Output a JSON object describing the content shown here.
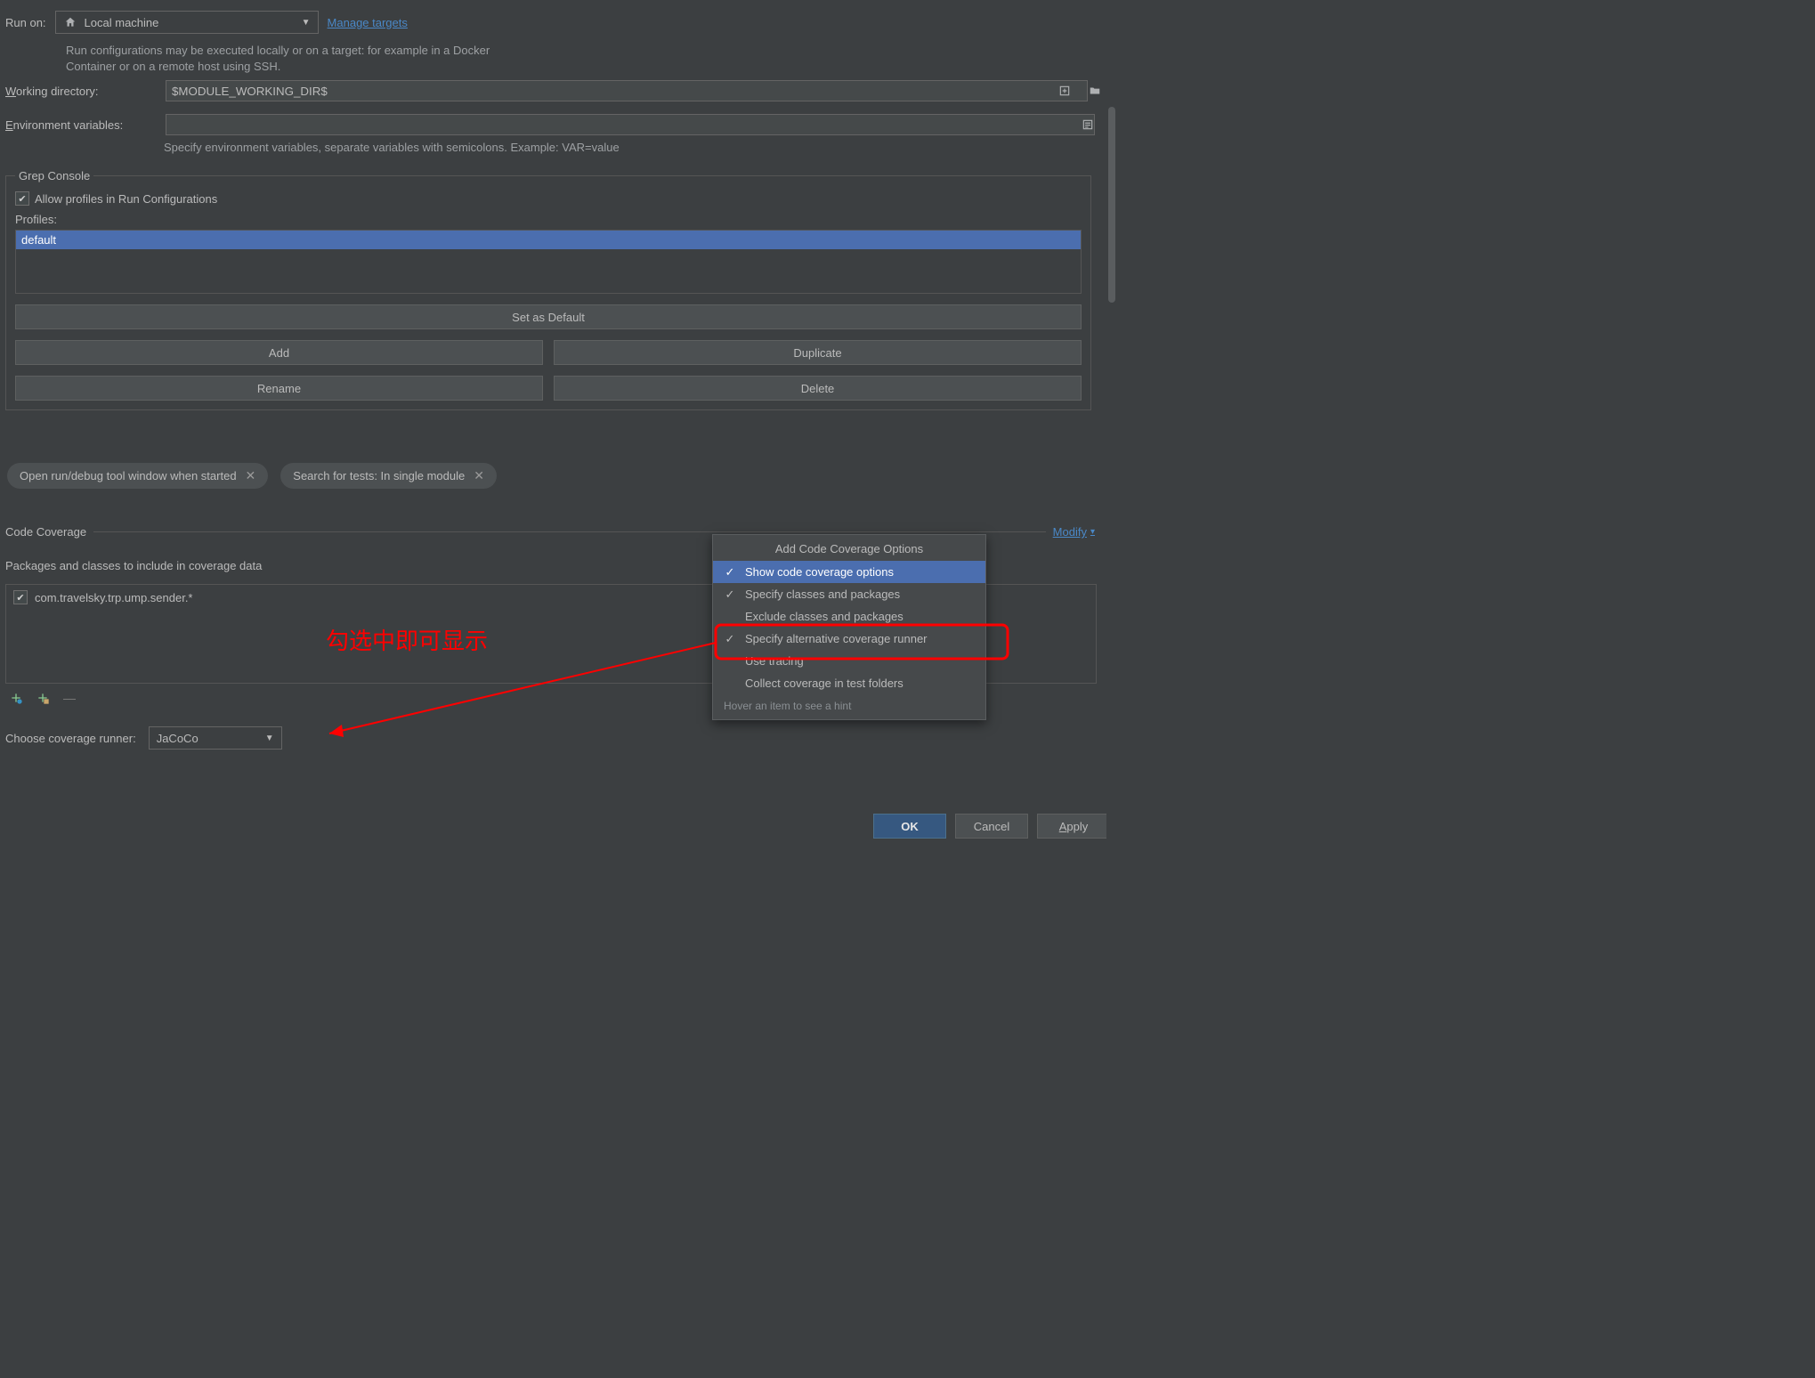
{
  "runOn": {
    "label": "Run on:",
    "value": "Local machine",
    "manage": "Manage targets",
    "hint": "Run configurations may be executed locally or on a target: for example in a Docker Container or on a remote host using SSH."
  },
  "workingDir": {
    "label": "Working directory:",
    "underlineChar": "W",
    "value": "$MODULE_WORKING_DIR$"
  },
  "envVars": {
    "label": "Environment variables:",
    "underlineChar": "E",
    "value": "",
    "hint": "Specify environment variables, separate variables with semicolons. Example: VAR=value"
  },
  "grepConsole": {
    "legend": "Grep Console",
    "allowLabel": "Allow profiles in Run Configurations",
    "allowChecked": true,
    "profilesLabel": "Profiles:",
    "profiles": [
      "default"
    ],
    "buttons": {
      "setDefault": "Set as Default",
      "add": "Add",
      "duplicate": "Duplicate",
      "rename": "Rename",
      "delete": "Delete"
    }
  },
  "tags": {
    "openToolWindow": "Open run/debug tool window when started",
    "searchTests": "Search for tests: In single module"
  },
  "codeCoverage": {
    "sectionLabel": "Code Coverage",
    "modifyLabel": "Modify",
    "packagesLabel": "Packages and classes to include in coverage data",
    "entries": [
      {
        "checked": true,
        "text": "com.travelsky.trp.ump.sender.*"
      }
    ],
    "chooseRunnerLabel": "Choose coverage runner:",
    "chooseRunnerValue": "JaCoCo"
  },
  "popup": {
    "title": "Add Code Coverage Options",
    "items": [
      {
        "label": "Show code coverage options",
        "checked": true,
        "selected": true
      },
      {
        "label": "Specify classes and packages",
        "checked": true,
        "selected": false
      },
      {
        "label": "Exclude classes and packages",
        "checked": false,
        "selected": false
      },
      {
        "label": "Specify alternative coverage runner",
        "checked": true,
        "selected": false,
        "highlight": true
      },
      {
        "label": "Use tracing",
        "checked": false,
        "selected": false
      },
      {
        "label": "Collect coverage in test folders",
        "checked": false,
        "selected": false
      }
    ],
    "hint": "Hover an item to see a hint"
  },
  "annotation": {
    "text": "勾选中即可显示"
  },
  "dialogButtons": {
    "ok": "OK",
    "cancel": "Cancel",
    "apply": "Apply",
    "applyUnderline": "A"
  }
}
